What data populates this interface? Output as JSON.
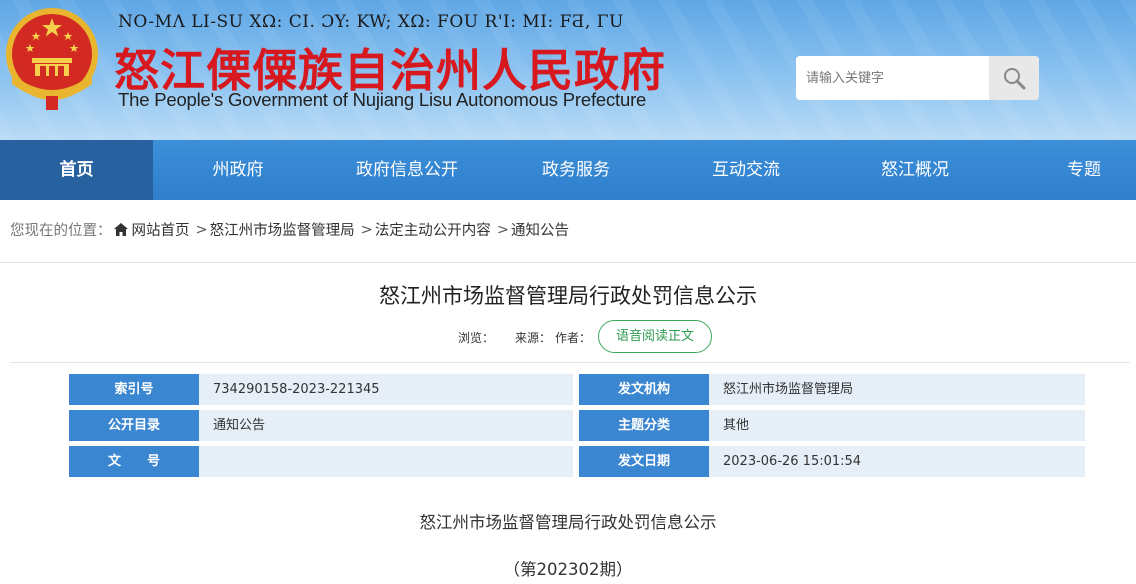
{
  "header": {
    "lisu_line": "NO-MΛ LI-SU XΩ: CI. ƆY: KW; XΩ: FOU R'I: MI: FƋ, ΓU",
    "title_cn": "怒江傈僳族自治州人民政府",
    "title_en": "The People's Government of Nujiang Lisu Autonomous Prefecture",
    "search_placeholder": "请输入关键字",
    "search_icon": "magnifier-icon",
    "emblem_icon": "national-emblem-icon"
  },
  "nav": {
    "items": [
      {
        "label": "首页"
      },
      {
        "label": "州政府"
      },
      {
        "label": "政府信息公开"
      },
      {
        "label": "政务服务"
      },
      {
        "label": "互动交流"
      },
      {
        "label": "怒江概况"
      },
      {
        "label": "专题"
      }
    ]
  },
  "breadcrumb": {
    "prefix": "您现在的位置：",
    "items": [
      "网站首页",
      "怒江州市场监督管理局",
      "法定主动公开内容",
      "通知公告"
    ],
    "separator": ">"
  },
  "article": {
    "title": "怒江州市场监督管理局行政处罚信息公示",
    "views_label": "浏览：",
    "source_label": "来源：",
    "author_label": "作者：",
    "voice_button": "语音阅读正文"
  },
  "info_table": {
    "index_label": "索引号",
    "index_value": "734290158-2023-221345",
    "issuer_label": "发文机构",
    "issuer_value": "怒江州市场监督管理局",
    "catalog_label": "公开目录",
    "catalog_value": "通知公告",
    "topic_label": "主题分类",
    "topic_value": "其他",
    "doc_no_label": "文　　号",
    "doc_no_value": "",
    "date_label": "发文日期",
    "date_value": "2023-06-26 15:01:54"
  },
  "body": {
    "title": "怒江州市场监督管理局行政处罚信息公示",
    "issue": "（第202302期）"
  },
  "colors": {
    "header_blue": "#5fa7e6",
    "nav_blue": "#2f7fcd",
    "nav_active": "#27619f",
    "title_red": "#d7191f",
    "label_blue": "#3b86d0",
    "value_bg": "#e6eef8",
    "voice_green": "#2e9b52"
  }
}
